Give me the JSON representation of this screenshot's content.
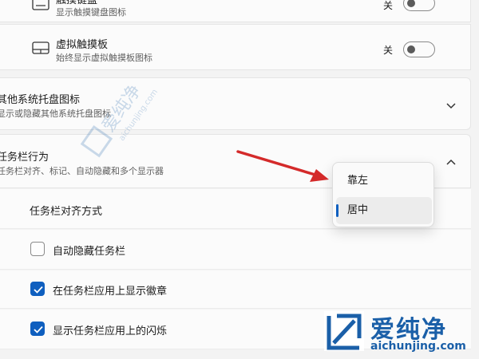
{
  "rows": {
    "touch_keyboard": {
      "title": "触摸键盘",
      "subtitle": "显示触摸键盘图标",
      "toggle_label": "关"
    },
    "virtual_touchpad": {
      "title": "虚拟触摸板",
      "subtitle": "始终显示虚拟触摸板图标",
      "toggle_label": "关"
    },
    "other_tray_icons": {
      "title": "其他系统托盘图标",
      "subtitle": "显示或隐藏其他系统托盘图标"
    },
    "taskbar_behaviors": {
      "title": "任务栏行为",
      "subtitle": "任务栏对齐、标记、自动隐藏和多个显示器"
    }
  },
  "behaviors": {
    "alignment_label": "任务栏对齐方式",
    "auto_hide_label": "自动隐藏任务栏",
    "auto_hide_checked": false,
    "show_badges_label": "在任务栏应用上显示徽章",
    "show_badges_checked": true,
    "show_flashing_label": "显示任务栏应用上的闪烁",
    "show_flashing_checked": true
  },
  "alignment_dropdown": {
    "options": [
      "靠左",
      "居中"
    ],
    "selected": "居中"
  },
  "watermark": {
    "brand": "爱纯净",
    "url": "aichunjing.com"
  },
  "colors": {
    "accent": "#0f5fbf",
    "arrow": "#d42a2a",
    "watermark": "#1a5fa8"
  }
}
